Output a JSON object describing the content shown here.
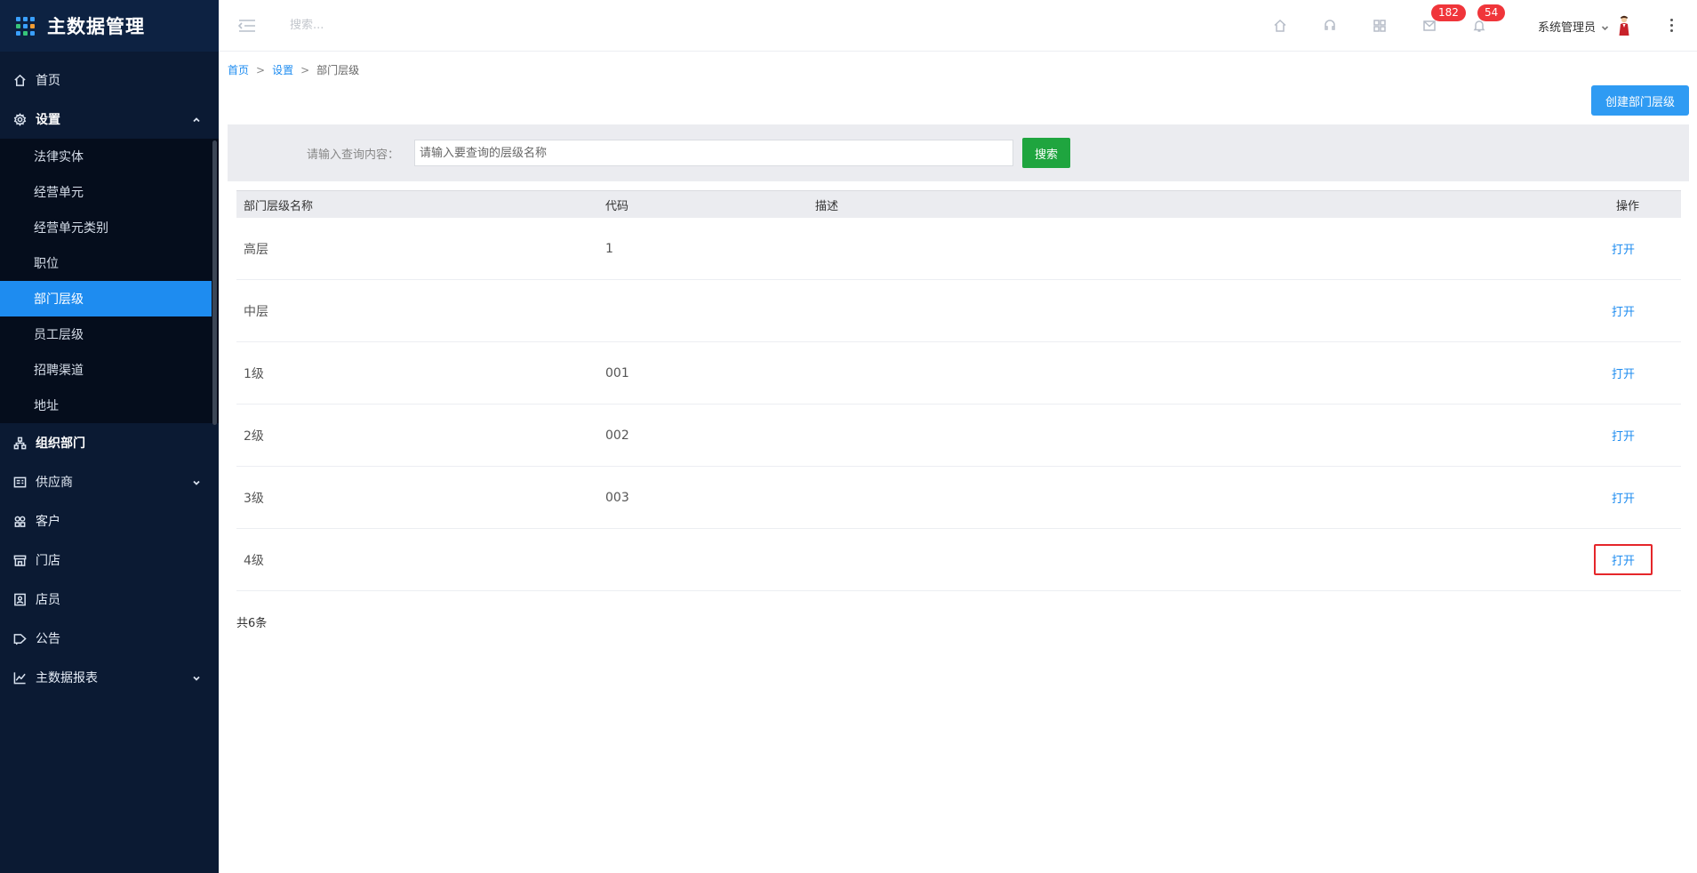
{
  "app": {
    "title": "主数据管理"
  },
  "sidebar": {
    "items": [
      {
        "label": "首页",
        "icon": "home-icon"
      },
      {
        "label": "设置",
        "icon": "gear-icon"
      },
      {
        "label": "组织部门",
        "icon": "org-tree-icon"
      },
      {
        "label": "供应商",
        "icon": "supplier-icon"
      },
      {
        "label": "客户",
        "icon": "customer-icon"
      },
      {
        "label": "门店",
        "icon": "store-icon"
      },
      {
        "label": "店员",
        "icon": "clerk-icon"
      },
      {
        "label": "公告",
        "icon": "announcement-icon"
      },
      {
        "label": "主数据报表",
        "icon": "chart-icon"
      }
    ],
    "settings_sub": [
      {
        "label": "法律实体"
      },
      {
        "label": "经营单元"
      },
      {
        "label": "经营单元类别"
      },
      {
        "label": "职位"
      },
      {
        "label": "部门层级",
        "active": true
      },
      {
        "label": "员工层级"
      },
      {
        "label": "招聘渠道"
      },
      {
        "label": "地址"
      }
    ]
  },
  "header": {
    "search_placeholder": "搜索...",
    "mail_badge": "182",
    "bell_badge": "54",
    "user": "系统管理员"
  },
  "breadcrumb": {
    "home": "首页",
    "sep": ">",
    "settings": "设置",
    "current": "部门层级"
  },
  "actions": {
    "create_label": "创建部门层级"
  },
  "search": {
    "label": "请输入查询内容：",
    "placeholder": "请输入要查询的层级名称",
    "button": "搜索"
  },
  "table": {
    "headers": {
      "name": "部门层级名称",
      "code": "代码",
      "desc": "描述",
      "op": "操作"
    },
    "rows": [
      {
        "name": "高层",
        "code": "1",
        "desc": "",
        "op": "打开"
      },
      {
        "name": "中层",
        "code": "",
        "desc": "",
        "op": "打开"
      },
      {
        "name": "1级",
        "code": "001",
        "desc": "",
        "op": "打开"
      },
      {
        "name": "2级",
        "code": "002",
        "desc": "",
        "op": "打开"
      },
      {
        "name": "3级",
        "code": "003",
        "desc": "",
        "op": "打开"
      },
      {
        "name": "4级",
        "code": "",
        "desc": "",
        "op": "打开"
      }
    ],
    "total": "共6条"
  },
  "colors": {
    "sidebar_bg": "#0b1a33",
    "accent": "#1e8cf0",
    "search_btn": "#1fa53f",
    "badge": "#f0353a",
    "highlight_border": "#e5262a"
  }
}
